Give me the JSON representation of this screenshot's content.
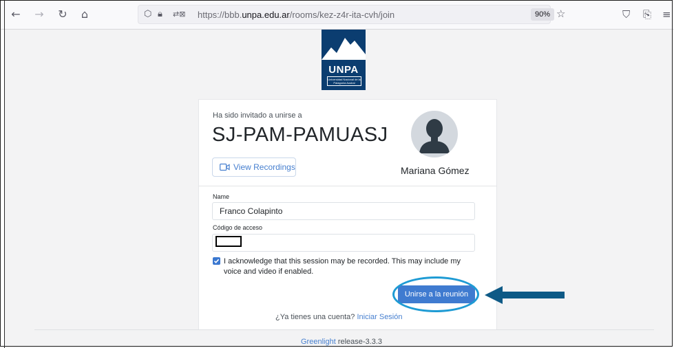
{
  "browser": {
    "url_prefix": "https://bbb.",
    "url_domain": "unpa.edu.ar",
    "url_path": "/rooms/kez-z4r-ita-cvh/join",
    "zoom": "90%",
    "icons": [
      "back-icon",
      "forward-icon",
      "reload-icon",
      "home-icon",
      "shield-icon",
      "lock-icon",
      "permissions-icon",
      "bookmark-star-icon",
      "pocket-icon",
      "extensions-icon",
      "menu-icon"
    ]
  },
  "logo": {
    "title": "UNPA",
    "subtitle": "Universidad Nacional de la Patagonia Austral"
  },
  "room": {
    "invited_text": "Ha sido invitado a unirse a",
    "name": "SJ-PAM-PAMUASJ",
    "view_recordings": "View Recordings",
    "owner": "Mariana Gómez"
  },
  "form": {
    "name_label": "Name",
    "name_value": "Franco Colapinto",
    "code_label": "Código de acceso",
    "code_value": "",
    "ack_text": "I acknowledge that this session may be recorded. This may include my voice and video if enabled.",
    "ack_checked": true,
    "join_button": "Unirse a la reunión"
  },
  "account": {
    "question": "¿Ya tienes una cuenta?",
    "signin": "Iniciar Sesión"
  },
  "footer": {
    "app": "Greenlight",
    "release": " release-3.3.3"
  },
  "colors": {
    "primary": "#3f7bd0",
    "annotation": "#1e9bd4",
    "arrow": "#0e5a86",
    "logo_bg": "#0b3d70"
  }
}
